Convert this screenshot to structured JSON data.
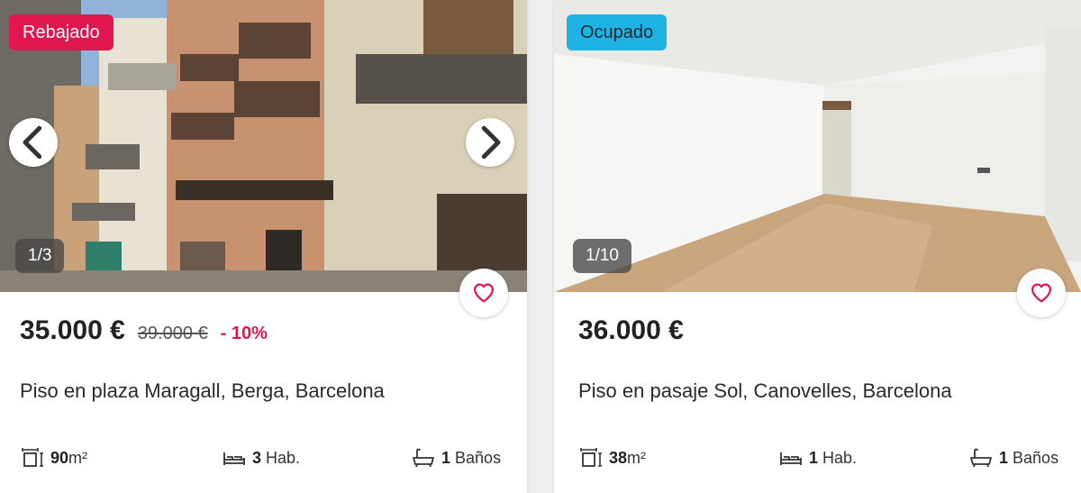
{
  "listings": [
    {
      "badge": "Rebajado",
      "counter": "1/3",
      "price": "35.000 €",
      "old_price": "39.000 €",
      "discount": "- 10%",
      "title": "Piso en plaza Maragall, Berga, Barcelona",
      "area_value": "90",
      "area_unit": "m²",
      "rooms_value": "3",
      "rooms_unit": "Hab.",
      "baths_value": "1",
      "baths_unit": "Baños"
    },
    {
      "badge": "Ocupado",
      "counter": "1/10",
      "price": "36.000 €",
      "title": "Piso en pasaje Sol, Canovelles, Barcelona",
      "area_value": "38",
      "area_unit": "m²",
      "rooms_value": "1",
      "rooms_unit": "Hab.",
      "baths_value": "1",
      "baths_unit": "Baños"
    }
  ],
  "colors": {
    "badge_reduced": "#e0174f",
    "badge_occupied": "#1fb2e4",
    "discount": "#e0174f",
    "heart": "#e0174f"
  },
  "icons": [
    "chevron-left-icon",
    "chevron-right-icon",
    "heart-icon",
    "area-icon",
    "bed-icon",
    "bathtub-icon"
  ]
}
